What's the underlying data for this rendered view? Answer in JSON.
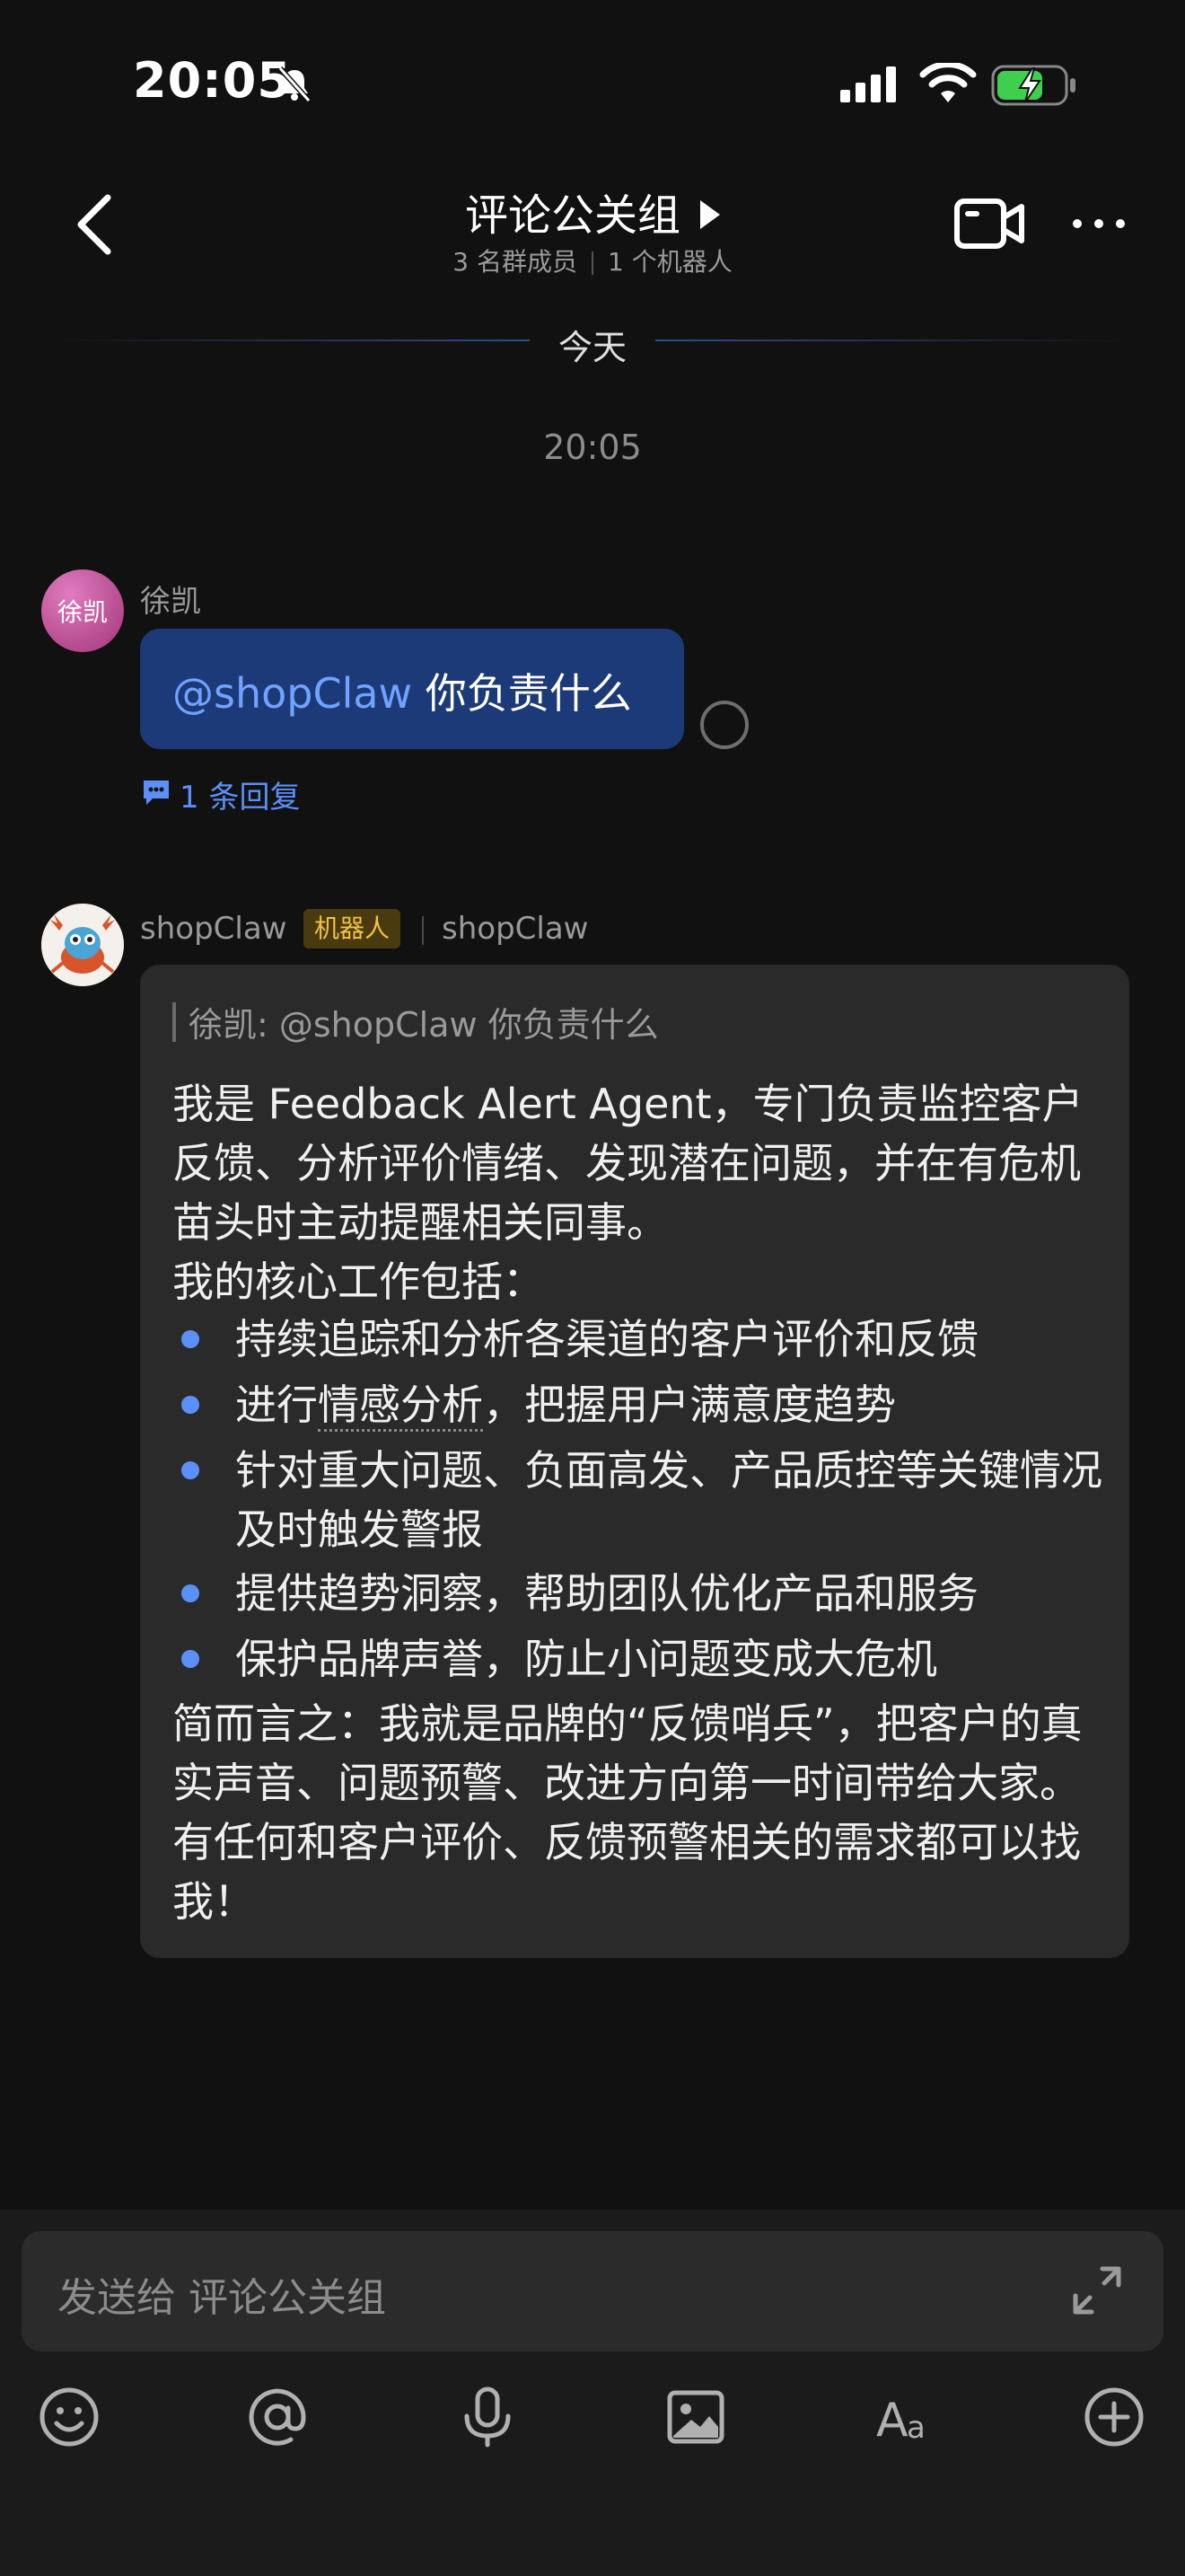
{
  "status_bar": {
    "time": "20:05"
  },
  "header": {
    "title": "评论公关组",
    "members": "3 名群成员",
    "bots": "1 个机器人"
  },
  "timeline": {
    "day": "今天",
    "time": "20:05"
  },
  "messages": [
    {
      "avatar_text": "徐凯",
      "sender": "徐凯",
      "mention": "@shopClaw",
      "text": " 你负责什么",
      "reply_count": "1 条回复"
    },
    {
      "sender": "shopClaw",
      "badge": "机器人",
      "sender_secondary": "shopClaw",
      "quote": "徐凯: @shopClaw 你负责什么",
      "intro": "我是 Feedback Alert Agent，专门负责监控客户反馈、分析评价情绪、发现潜在问题，并在有危机苗头时主动提醒相关同事。",
      "list_heading": "我的核心工作包括：",
      "bullets": [
        "持续追踪和分析各渠道的客户评价和反馈",
        "把握用户满意度趋势",
        "针对重大问题、负面高发、产品质控等关键情况及时触发警报",
        "提供趋势洞察，帮助团队优化产品和服务",
        "保护品牌声誉，防止小问题变成大危机"
      ],
      "bullet2_prefix": "进行",
      "bullet2_link": "情感分析",
      "bullet2_suffix": "，",
      "summary": "简而言之：我就是品牌的“反馈哨兵”，把客户的真实声音、问题预警、改进方向第一时间带给大家。有任何和客户评价、反馈预警相关的需求都可以找我！"
    }
  ],
  "composer": {
    "placeholder": "发送给 评论公关组",
    "toolbar": [
      "emoji-icon",
      "mention-icon",
      "microphone-icon",
      "image-icon",
      "text-format-icon",
      "add-icon"
    ]
  },
  "colors": {
    "accent": "#5b8ff9",
    "bubble_self": "#1d3a78",
    "bubble_other": "#2a2a2a",
    "badge": "#f3c244"
  }
}
